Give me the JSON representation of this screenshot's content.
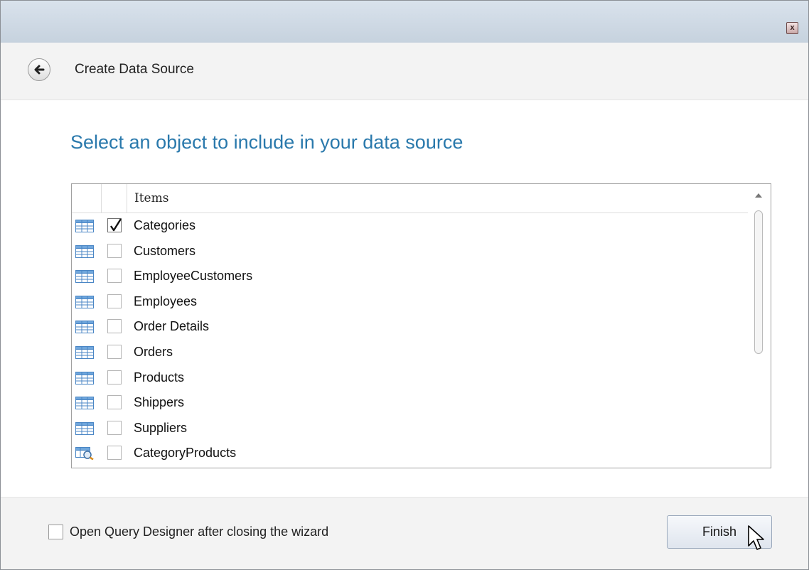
{
  "window": {
    "close_label": "x"
  },
  "nav": {
    "title": "Create Data Source",
    "back_icon": "back-arrow-icon"
  },
  "heading": "Select an object to include in your data source",
  "grid": {
    "header": "Items",
    "items": [
      {
        "label": "Categories",
        "checked": true,
        "icon": "table-icon"
      },
      {
        "label": "Customers",
        "checked": false,
        "icon": "table-icon"
      },
      {
        "label": "EmployeeCustomers",
        "checked": false,
        "icon": "table-icon"
      },
      {
        "label": "Employees",
        "checked": false,
        "icon": "table-icon"
      },
      {
        "label": "Order Details",
        "checked": false,
        "icon": "table-icon"
      },
      {
        "label": "Orders",
        "checked": false,
        "icon": "table-icon"
      },
      {
        "label": "Products",
        "checked": false,
        "icon": "table-icon"
      },
      {
        "label": "Shippers",
        "checked": false,
        "icon": "table-icon"
      },
      {
        "label": "Suppliers",
        "checked": false,
        "icon": "table-icon"
      },
      {
        "label": "CategoryProducts",
        "checked": false,
        "icon": "view-icon"
      }
    ]
  },
  "footer": {
    "open_designer_label": "Open Query Designer after closing the wizard",
    "open_designer_checked": false,
    "finish_label": "Finish"
  },
  "colors": {
    "heading": "#2a79ac",
    "titlebar": "#c6d2de",
    "panel": "#f3f3f3"
  }
}
